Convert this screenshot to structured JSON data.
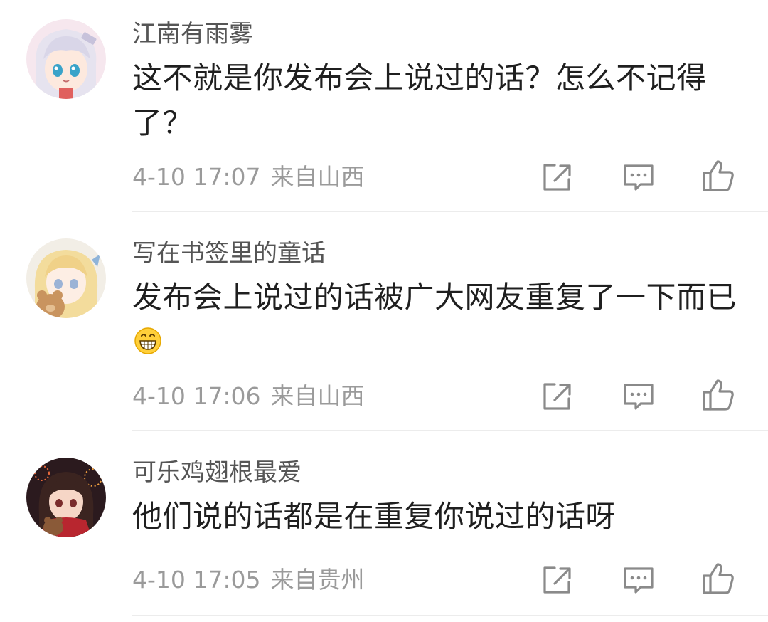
{
  "comments": [
    {
      "username": "江南有雨雾",
      "text": "这不就是你发布会上说过的话？怎么不记得了？",
      "time": "4-10 17:07",
      "location": "来自山西",
      "avatar": "avatar-anime-girl-silver-hair",
      "emoji": ""
    },
    {
      "username": "写在书签里的童话",
      "text": "发布会上说过的话被广大网友重复了一下而已",
      "time": "4-10 17:06",
      "location": "来自山西",
      "avatar": "avatar-anime-girl-blonde-teddy-bear",
      "emoji": "grinning-face-emoji"
    },
    {
      "username": "可乐鸡翅根最爱",
      "text": "他们说的话都是在重复你说过的话呀",
      "time": "4-10 17:05",
      "location": "来自贵州",
      "avatar": "avatar-anime-girl-dark-hair-fireworks",
      "emoji": ""
    }
  ],
  "actions": [
    "share-icon",
    "reply-icon",
    "like-icon"
  ],
  "colors": {
    "username": "#555555",
    "text": "#1f1f1f",
    "meta": "#9a9a9a",
    "icon": "#8a8a8a",
    "divider": "#ececec"
  }
}
